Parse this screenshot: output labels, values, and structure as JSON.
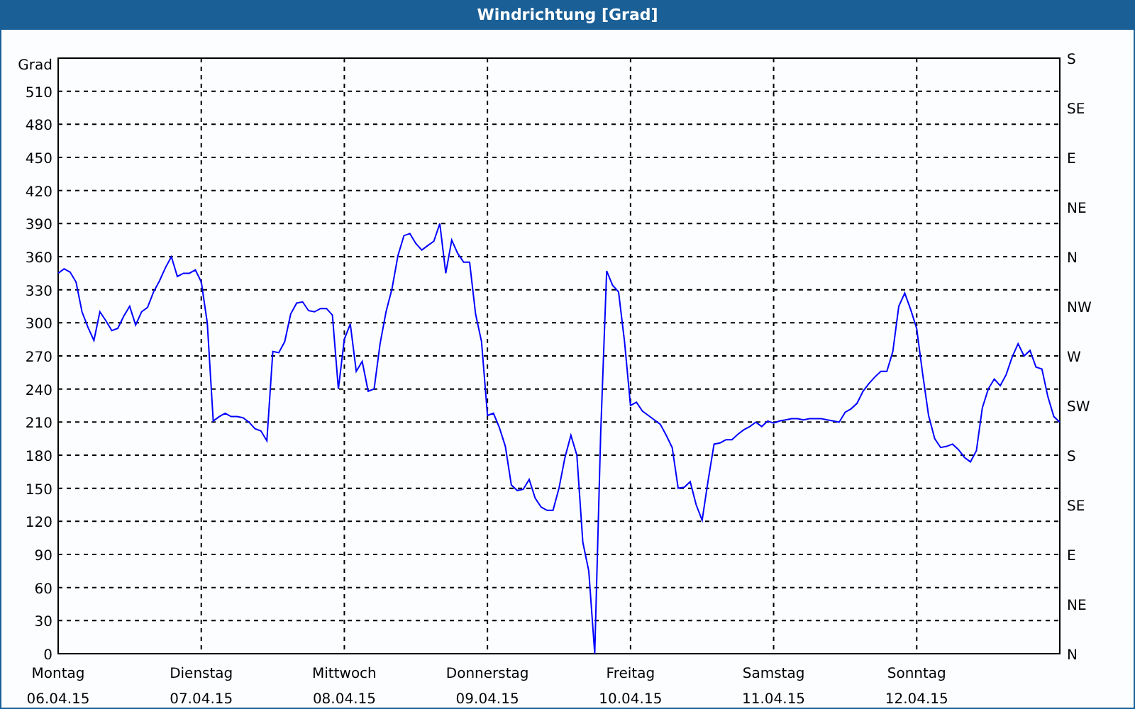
{
  "window": {
    "title": "Windrichtung [Grad]"
  },
  "chart": {
    "right_axis_labels": [
      "S",
      "SE",
      "E",
      "NE",
      "N",
      "NW",
      "W",
      "SW",
      "S",
      "SE",
      "E",
      "NE",
      "N"
    ],
    "chart_data": {
      "type": "line",
      "grid": true,
      "ylabel": "Grad",
      "ylim": [
        0,
        540
      ],
      "yticks": [
        0,
        30,
        60,
        90,
        120,
        150,
        180,
        210,
        240,
        270,
        300,
        330,
        360,
        390,
        420,
        450,
        480,
        510
      ],
      "categories": [
        "Montag 06.04.15",
        null,
        null,
        null,
        null,
        null,
        null,
        null,
        null,
        null,
        null,
        null,
        null,
        null,
        null,
        null,
        null,
        null,
        null,
        null,
        null,
        null,
        null,
        null,
        "Dienstag 07.04.15",
        null,
        null,
        null,
        null,
        null,
        null,
        null,
        null,
        null,
        null,
        null,
        null,
        null,
        null,
        null,
        null,
        null,
        null,
        null,
        null,
        null,
        null,
        null,
        "Mittwoch 08.04.15",
        null,
        null,
        null,
        null,
        null,
        null,
        null,
        null,
        null,
        null,
        null,
        null,
        null,
        null,
        null,
        null,
        null,
        null,
        null,
        null,
        null,
        null,
        null,
        "Donnerstag 09.04.15",
        null,
        null,
        null,
        null,
        null,
        null,
        null,
        null,
        null,
        null,
        null,
        null,
        null,
        null,
        null,
        null,
        null,
        null,
        null,
        null,
        null,
        null,
        null,
        "Freitag 10.04.15",
        null,
        null,
        null,
        null,
        null,
        null,
        null,
        null,
        null,
        null,
        null,
        null,
        null,
        null,
        null,
        null,
        null,
        null,
        null,
        null,
        null,
        null,
        null,
        "Samstag 11.04.15",
        null,
        null,
        null,
        null,
        null,
        null,
        null,
        null,
        null,
        null,
        null,
        null,
        null,
        null,
        null,
        null,
        null,
        null,
        null,
        null,
        null,
        null,
        null,
        "Sonntag 12.04.15",
        null,
        null,
        null,
        null,
        null,
        null,
        null,
        null,
        null,
        null,
        null,
        null,
        null,
        null,
        null,
        null,
        null,
        null,
        null,
        null,
        null,
        null,
        null,
        null
      ],
      "series": [
        {
          "color": "#0000ff",
          "values": [
            345,
            349,
            346,
            337,
            310,
            296,
            284,
            310,
            302,
            293,
            295,
            306,
            315,
            298,
            310,
            314,
            328,
            338,
            350,
            360,
            342,
            345,
            345,
            348,
            337,
            300,
            211,
            215,
            218,
            215,
            215,
            214,
            210,
            204,
            202,
            193,
            274,
            273,
            283,
            308,
            318,
            319,
            311,
            310,
            313,
            313,
            307,
            240,
            285,
            299,
            256,
            265,
            238,
            240,
            281,
            310,
            331,
            361,
            379,
            381,
            372,
            366,
            370,
            374,
            390,
            345,
            375,
            363,
            355,
            355,
            308,
            283,
            216,
            218,
            205,
            188,
            153,
            148,
            149,
            158,
            141,
            133,
            130,
            130,
            150,
            178,
            198,
            180,
            101,
            75,
            0,
            200,
            347,
            334,
            328,
            283,
            225,
            228,
            220,
            216,
            212,
            208,
            198,
            187,
            150,
            151,
            156,
            135,
            121,
            157,
            190,
            191,
            194,
            194,
            199,
            203,
            206,
            210,
            206,
            211,
            209,
            211,
            212,
            213,
            213,
            212,
            213,
            213,
            213,
            212,
            211,
            210,
            219,
            222,
            227,
            238,
            245,
            251,
            256,
            256,
            274,
            315,
            327,
            312,
            295,
            254,
            216,
            195,
            187,
            188,
            190,
            185,
            178,
            174,
            184,
            223,
            240,
            249,
            243,
            253,
            269,
            281,
            270,
            275,
            260,
            258,
            233,
            215,
            210
          ]
        }
      ]
    }
  }
}
